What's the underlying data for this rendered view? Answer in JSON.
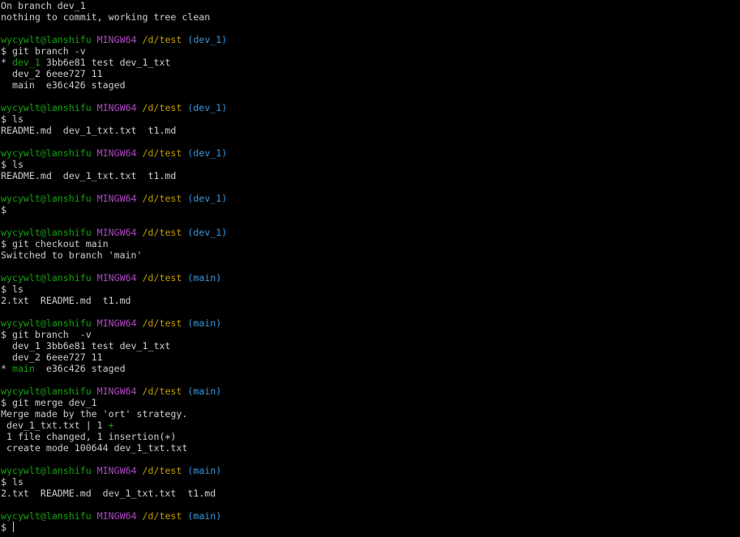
{
  "colors": {
    "background": "#000000",
    "text": "#cccccc",
    "user_host": "#13a10e",
    "env": "#b148c6",
    "path": "#c19c00",
    "branch": "#3a96dd",
    "current_branch": "#13a10e",
    "diff_plus": "#13a10e"
  },
  "lines": [
    {
      "segs": [
        {
          "t": "On branch dev_1",
          "c": "w"
        }
      ]
    },
    {
      "segs": [
        {
          "t": "nothing to commit, working tree clean",
          "c": "w"
        }
      ]
    },
    {
      "segs": []
    },
    {
      "segs": [
        {
          "t": "wycywlt@lanshifu",
          "c": "g"
        },
        {
          "t": " ",
          "c": "w"
        },
        {
          "t": "MINGW64",
          "c": "m"
        },
        {
          "t": " ",
          "c": "w"
        },
        {
          "t": "/d/test",
          "c": "y"
        },
        {
          "t": " ",
          "c": "w"
        },
        {
          "t": "(dev_1)",
          "c": "c"
        }
      ]
    },
    {
      "segs": [
        {
          "t": "$ git branch -v",
          "c": "w"
        }
      ]
    },
    {
      "segs": [
        {
          "t": "* ",
          "c": "w"
        },
        {
          "t": "dev_1",
          "c": "g"
        },
        {
          "t": " 3bb6e81 test dev_1_txt",
          "c": "w"
        }
      ]
    },
    {
      "segs": [
        {
          "t": "  dev_2 6eee727 11",
          "c": "w"
        }
      ]
    },
    {
      "segs": [
        {
          "t": "  main  e36c426 staged",
          "c": "w"
        }
      ]
    },
    {
      "segs": []
    },
    {
      "segs": [
        {
          "t": "wycywlt@lanshifu",
          "c": "g"
        },
        {
          "t": " ",
          "c": "w"
        },
        {
          "t": "MINGW64",
          "c": "m"
        },
        {
          "t": " ",
          "c": "w"
        },
        {
          "t": "/d/test",
          "c": "y"
        },
        {
          "t": " ",
          "c": "w"
        },
        {
          "t": "(dev_1)",
          "c": "c"
        }
      ]
    },
    {
      "segs": [
        {
          "t": "$ ls",
          "c": "w"
        }
      ]
    },
    {
      "segs": [
        {
          "t": "README.md  dev_1_txt.txt  t1.md",
          "c": "w"
        }
      ]
    },
    {
      "segs": []
    },
    {
      "segs": [
        {
          "t": "wycywlt@lanshifu",
          "c": "g"
        },
        {
          "t": " ",
          "c": "w"
        },
        {
          "t": "MINGW64",
          "c": "m"
        },
        {
          "t": " ",
          "c": "w"
        },
        {
          "t": "/d/test",
          "c": "y"
        },
        {
          "t": " ",
          "c": "w"
        },
        {
          "t": "(dev_1)",
          "c": "c"
        }
      ]
    },
    {
      "segs": [
        {
          "t": "$ ls",
          "c": "w"
        }
      ]
    },
    {
      "segs": [
        {
          "t": "README.md  dev_1_txt.txt  t1.md",
          "c": "w"
        }
      ]
    },
    {
      "segs": []
    },
    {
      "segs": [
        {
          "t": "wycywlt@lanshifu",
          "c": "g"
        },
        {
          "t": " ",
          "c": "w"
        },
        {
          "t": "MINGW64",
          "c": "m"
        },
        {
          "t": " ",
          "c": "w"
        },
        {
          "t": "/d/test",
          "c": "y"
        },
        {
          "t": " ",
          "c": "w"
        },
        {
          "t": "(dev_1)",
          "c": "c"
        }
      ]
    },
    {
      "segs": [
        {
          "t": "$",
          "c": "w"
        }
      ]
    },
    {
      "segs": []
    },
    {
      "segs": [
        {
          "t": "wycywlt@lanshifu",
          "c": "g"
        },
        {
          "t": " ",
          "c": "w"
        },
        {
          "t": "MINGW64",
          "c": "m"
        },
        {
          "t": " ",
          "c": "w"
        },
        {
          "t": "/d/test",
          "c": "y"
        },
        {
          "t": " ",
          "c": "w"
        },
        {
          "t": "(dev_1)",
          "c": "c"
        }
      ]
    },
    {
      "segs": [
        {
          "t": "$ git checkout main",
          "c": "w"
        }
      ]
    },
    {
      "segs": [
        {
          "t": "Switched to branch 'main'",
          "c": "w"
        }
      ]
    },
    {
      "segs": []
    },
    {
      "segs": [
        {
          "t": "wycywlt@lanshifu",
          "c": "g"
        },
        {
          "t": " ",
          "c": "w"
        },
        {
          "t": "MINGW64",
          "c": "m"
        },
        {
          "t": " ",
          "c": "w"
        },
        {
          "t": "/d/test",
          "c": "y"
        },
        {
          "t": " ",
          "c": "w"
        },
        {
          "t": "(main)",
          "c": "c"
        }
      ]
    },
    {
      "segs": [
        {
          "t": "$ ls",
          "c": "w"
        }
      ]
    },
    {
      "segs": [
        {
          "t": "2.txt  README.md  t1.md",
          "c": "w"
        }
      ]
    },
    {
      "segs": []
    },
    {
      "segs": [
        {
          "t": "wycywlt@lanshifu",
          "c": "g"
        },
        {
          "t": " ",
          "c": "w"
        },
        {
          "t": "MINGW64",
          "c": "m"
        },
        {
          "t": " ",
          "c": "w"
        },
        {
          "t": "/d/test",
          "c": "y"
        },
        {
          "t": " ",
          "c": "w"
        },
        {
          "t": "(main)",
          "c": "c"
        }
      ]
    },
    {
      "segs": [
        {
          "t": "$ git branch  -v",
          "c": "w"
        }
      ]
    },
    {
      "segs": [
        {
          "t": "  dev_1 3bb6e81 test dev_1_txt",
          "c": "w"
        }
      ]
    },
    {
      "segs": [
        {
          "t": "  dev_2 6eee727 11",
          "c": "w"
        }
      ]
    },
    {
      "segs": [
        {
          "t": "* ",
          "c": "w"
        },
        {
          "t": "main",
          "c": "g"
        },
        {
          "t": "  e36c426 staged",
          "c": "w"
        }
      ]
    },
    {
      "segs": []
    },
    {
      "segs": [
        {
          "t": "wycywlt@lanshifu",
          "c": "g"
        },
        {
          "t": " ",
          "c": "w"
        },
        {
          "t": "MINGW64",
          "c": "m"
        },
        {
          "t": " ",
          "c": "w"
        },
        {
          "t": "/d/test",
          "c": "y"
        },
        {
          "t": " ",
          "c": "w"
        },
        {
          "t": "(main)",
          "c": "c"
        }
      ]
    },
    {
      "segs": [
        {
          "t": "$ git merge dev_1",
          "c": "w"
        }
      ]
    },
    {
      "segs": [
        {
          "t": "Merge made by the 'ort' strategy.",
          "c": "w"
        }
      ]
    },
    {
      "segs": [
        {
          "t": " dev_1_txt.txt | 1 ",
          "c": "w"
        },
        {
          "t": "+",
          "c": "g"
        }
      ]
    },
    {
      "segs": [
        {
          "t": " 1 file changed, 1 insertion(+)",
          "c": "w"
        }
      ]
    },
    {
      "segs": [
        {
          "t": " create mode 100644 dev_1_txt.txt",
          "c": "w"
        }
      ]
    },
    {
      "segs": []
    },
    {
      "segs": [
        {
          "t": "wycywlt@lanshifu",
          "c": "g"
        },
        {
          "t": " ",
          "c": "w"
        },
        {
          "t": "MINGW64",
          "c": "m"
        },
        {
          "t": " ",
          "c": "w"
        },
        {
          "t": "/d/test",
          "c": "y"
        },
        {
          "t": " ",
          "c": "w"
        },
        {
          "t": "(main)",
          "c": "c"
        }
      ]
    },
    {
      "segs": [
        {
          "t": "$ ls",
          "c": "w"
        }
      ]
    },
    {
      "segs": [
        {
          "t": "2.txt  README.md  dev_1_txt.txt  t1.md",
          "c": "w"
        }
      ]
    },
    {
      "segs": []
    },
    {
      "segs": [
        {
          "t": "wycywlt@lanshifu",
          "c": "g"
        },
        {
          "t": " ",
          "c": "w"
        },
        {
          "t": "MINGW64",
          "c": "m"
        },
        {
          "t": " ",
          "c": "w"
        },
        {
          "t": "/d/test",
          "c": "y"
        },
        {
          "t": " ",
          "c": "w"
        },
        {
          "t": "(main)",
          "c": "c"
        }
      ]
    },
    {
      "segs": [
        {
          "t": "$ ",
          "c": "w"
        }
      ],
      "cursor": true
    }
  ]
}
